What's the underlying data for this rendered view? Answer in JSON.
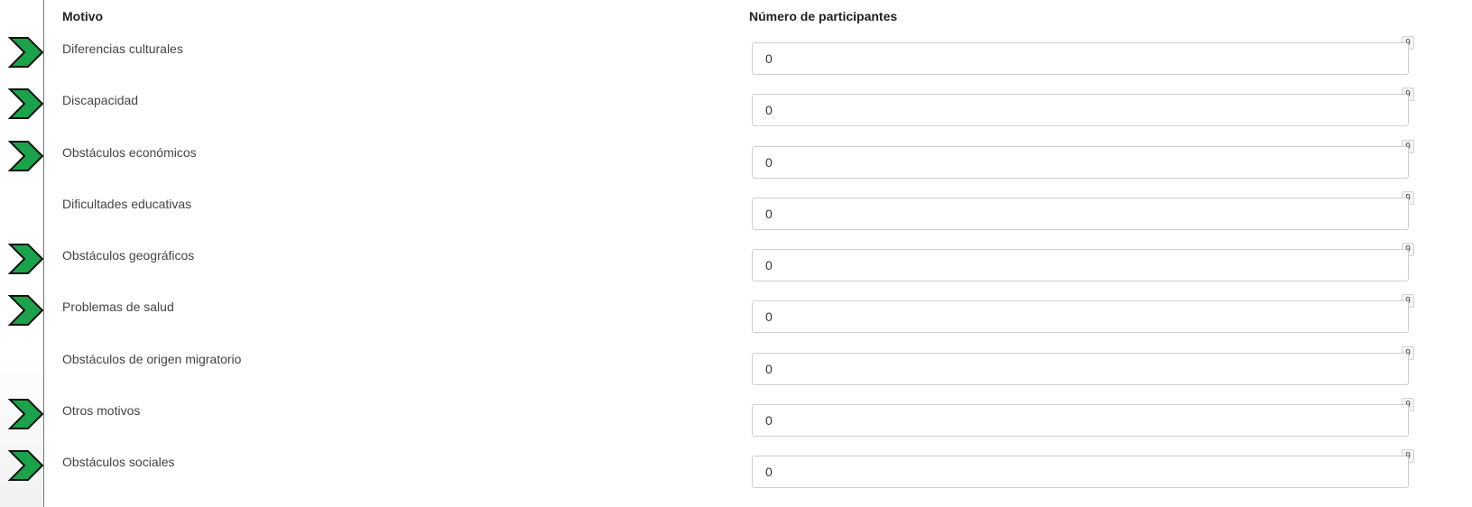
{
  "headers": {
    "reason": "Motivo",
    "participants": "Número de participantes"
  },
  "rows": [
    {
      "label": "Diferencias culturales",
      "value": "0",
      "counter": "9",
      "marked": true
    },
    {
      "label": "Discapacidad",
      "value": "0",
      "counter": "9",
      "marked": true
    },
    {
      "label": "Obstáculos económicos",
      "value": "0",
      "counter": "9",
      "marked": true
    },
    {
      "label": "Dificultades educativas",
      "value": "0",
      "counter": "9",
      "marked": false
    },
    {
      "label": "Obstáculos geográficos",
      "value": "0",
      "counter": "9",
      "marked": true
    },
    {
      "label": "Problemas de salud",
      "value": "0",
      "counter": "9",
      "marked": true
    },
    {
      "label": "Obstáculos de origen migratorio",
      "value": "0",
      "counter": "9",
      "marked": false
    },
    {
      "label": "Otros motivos",
      "value": "0",
      "counter": "9",
      "marked": true
    },
    {
      "label": "Obstáculos sociales",
      "value": "0",
      "counter": "9",
      "marked": true
    }
  ],
  "colors": {
    "arrow_fill": "#1aa34a",
    "arrow_stroke": "#111111"
  },
  "icons": {
    "marker": "chevron-right-arrow-icon"
  }
}
